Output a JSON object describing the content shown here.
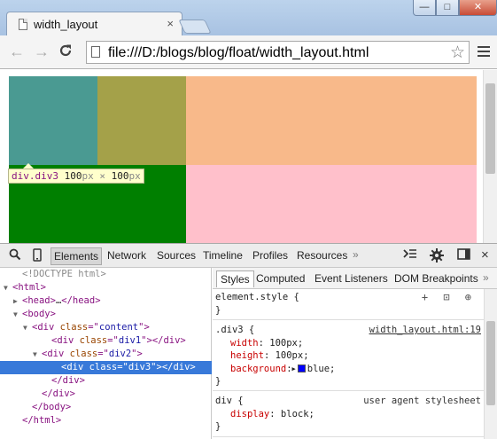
{
  "window": {
    "tab_title": "width_layout",
    "close_glyph": "×",
    "min_glyph": "—",
    "max_glyph": "□",
    "win_close_glyph": "✕"
  },
  "toolbar": {
    "back_icon": "←",
    "forward_icon": "→",
    "reload_icon": "C",
    "url": "file:///D:/blogs/blog/float/width_layout.html",
    "star_icon": "☆"
  },
  "page": {
    "colors": {
      "div1": "#4a9a92",
      "div2": "#a4a149",
      "rest_top": "#f8b98a",
      "div3": "#007f00",
      "rest_bottom": "#ffc0cb"
    },
    "tooltip": {
      "tag": "div.div3",
      "width": "100",
      "unit1": "px",
      "times": "×",
      "height": "100",
      "unit2": "px"
    }
  },
  "devtools": {
    "tabs": [
      "Elements",
      "Network",
      "Sources",
      "Timeline",
      "Profiles",
      "Resources"
    ],
    "more": "»",
    "close": "×",
    "dom_tree": [
      {
        "indent": 1,
        "tri": "",
        "html": "<!DOCTYPE html>",
        "parts": [
          {
            "c": "cm",
            "t": "<!DOCTYPE html>"
          }
        ]
      },
      {
        "indent": 0,
        "tri": "▼",
        "parts": [
          {
            "c": "tg",
            "t": "<html>"
          }
        ]
      },
      {
        "indent": 1,
        "tri": "▶",
        "parts": [
          {
            "c": "tg",
            "t": "<head>"
          },
          {
            "c": "",
            "t": "…"
          },
          {
            "c": "tg",
            "t": "</head>"
          }
        ]
      },
      {
        "indent": 1,
        "tri": "▼",
        "parts": [
          {
            "c": "tg",
            "t": "<body>"
          }
        ]
      },
      {
        "indent": 2,
        "tri": "▼",
        "parts": [
          {
            "c": "tg",
            "t": "<div "
          },
          {
            "c": "at",
            "t": "class"
          },
          {
            "c": "tg",
            "t": "=\""
          },
          {
            "c": "av",
            "t": "content"
          },
          {
            "c": "tg",
            "t": "\">"
          }
        ]
      },
      {
        "indent": 4,
        "tri": "",
        "parts": [
          {
            "c": "tg",
            "t": "<div "
          },
          {
            "c": "at",
            "t": "class"
          },
          {
            "c": "tg",
            "t": "=\""
          },
          {
            "c": "av",
            "t": "div1"
          },
          {
            "c": "tg",
            "t": "\"></div>"
          }
        ]
      },
      {
        "indent": 3,
        "tri": "▼",
        "parts": [
          {
            "c": "tg",
            "t": "<div "
          },
          {
            "c": "at",
            "t": "class"
          },
          {
            "c": "tg",
            "t": "=\""
          },
          {
            "c": "av",
            "t": "div2"
          },
          {
            "c": "tg",
            "t": "\">"
          }
        ]
      },
      {
        "indent": 5,
        "tri": "",
        "selected": true,
        "parts": [
          {
            "c": "tg",
            "t": "<div "
          },
          {
            "c": "at",
            "t": "class"
          },
          {
            "c": "tg",
            "t": "=\""
          },
          {
            "c": "av",
            "t": "div3"
          },
          {
            "c": "tg",
            "t": "\"></div>"
          }
        ]
      },
      {
        "indent": 4,
        "tri": "",
        "parts": [
          {
            "c": "tg",
            "t": "</div>"
          }
        ]
      },
      {
        "indent": 3,
        "tri": "",
        "parts": [
          {
            "c": "tg",
            "t": "</div>"
          }
        ]
      },
      {
        "indent": 2,
        "tri": "",
        "parts": [
          {
            "c": "tg",
            "t": "</body>"
          }
        ]
      },
      {
        "indent": 1,
        "tri": "",
        "parts": [
          {
            "c": "tg",
            "t": "</html>"
          }
        ]
      }
    ],
    "styles_tabs": [
      "Styles",
      "Computed",
      "Event Listeners",
      "DOM Breakpoints"
    ],
    "styles_more": "»",
    "element_style": {
      "selector": "element.style {",
      "close": "}",
      "tools": "+ ⊡ ⊕"
    },
    "rule_div3": {
      "selector": ".div3 {",
      "source": "width_layout.html:19",
      "props": [
        {
          "name": "width",
          "value": "100px;"
        },
        {
          "name": "height",
          "value": "100px;"
        },
        {
          "name": "background",
          "value": "blue;"
        }
      ],
      "close": "}"
    },
    "rule_div": {
      "selector": "div {",
      "source": "user agent stylesheet",
      "props": [
        {
          "name": "display",
          "value": "block;"
        }
      ],
      "close": "}"
    }
  }
}
